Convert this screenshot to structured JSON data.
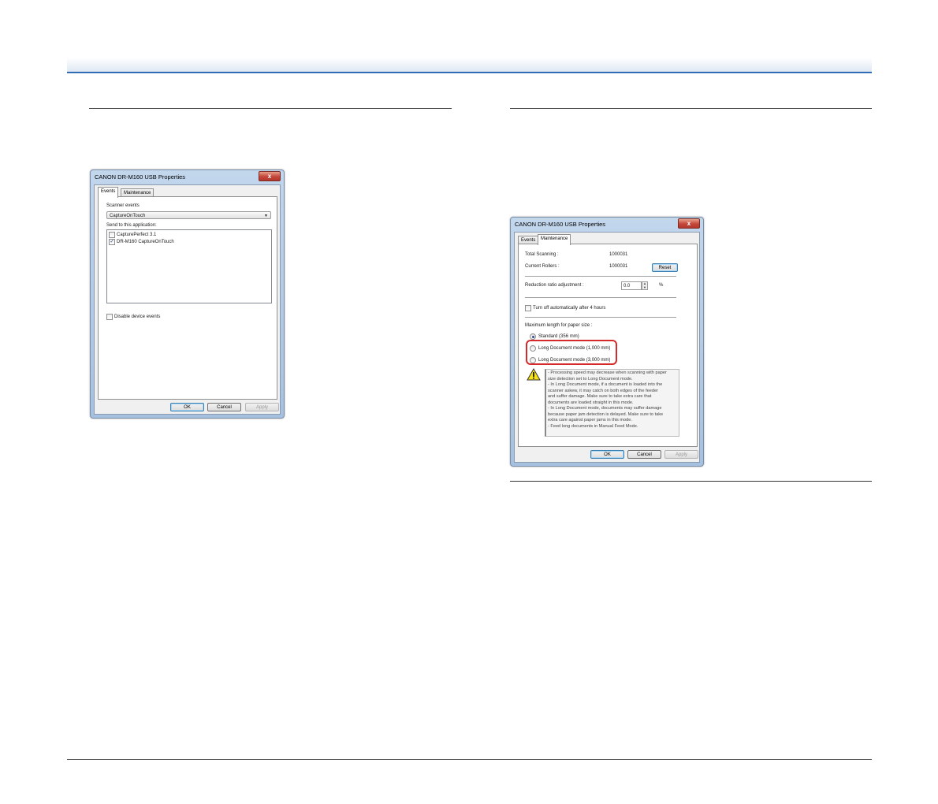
{
  "dialog_events": {
    "title": "CANON DR-M160 USB Properties",
    "close_label": "x",
    "tabs": [
      {
        "label": "Events"
      },
      {
        "label": "Maintenance"
      }
    ],
    "scanner_events_label": "Scanner events",
    "scanner_events_value": "CaptureOnTouch",
    "send_to_label": "Send to this application:",
    "applications": [
      {
        "label": "CapturePerfect 3.1",
        "checked": false
      },
      {
        "label": "DR-M160 CaptureOnTouch",
        "checked": true
      }
    ],
    "disable_events_label": "Disable device events",
    "buttons": {
      "ok": "OK",
      "cancel": "Cancel",
      "apply": "Apply"
    }
  },
  "dialog_maintenance": {
    "title": "CANON DR-M160 USB Properties",
    "close_label": "x",
    "tabs": [
      {
        "label": "Events"
      },
      {
        "label": "Maintenance"
      }
    ],
    "total_scanning_label": "Total Scanning :",
    "total_scanning_value": "1000031",
    "current_rollers_label": "Current Rollers :",
    "current_rollers_value": "1000031",
    "reset_label": "Reset",
    "reduction_label": "Reduction ratio adjustment :",
    "reduction_value": "0.0",
    "reduction_unit": "%",
    "turn_off_label": "Turn off automatically after 4 hours",
    "max_length_label": "Maximum length for paper size :",
    "radio_options": [
      {
        "label": "Standard (356 mm)",
        "selected": true
      },
      {
        "label": "Long Document mode (1,000 mm)",
        "selected": false
      },
      {
        "label": "Long Document mode (3,000 mm)",
        "selected": false
      }
    ],
    "warning_lines": [
      "- Processing speed may decrease when scanning with paper",
      "size detection set to Long Document mode.",
      "- In Long Document mode, if a document is loaded into the",
      "scanner askew, it may catch on both edges of the feeder",
      "and suffer damage. Make sure to take extra care that",
      "documents are loaded straight in this mode.",
      "- In Long Document mode, documents may suffer damage",
      "because paper jam detection is delayed. Make sure to take",
      "extra care against paper jams in this mode.",
      "- Feed long documents in Manual Feed Mode."
    ],
    "buttons": {
      "ok": "OK",
      "cancel": "Cancel",
      "apply": "Apply"
    }
  },
  "colors": {
    "header_rule": "#2f6db5",
    "highlight": "#d42a2a"
  }
}
